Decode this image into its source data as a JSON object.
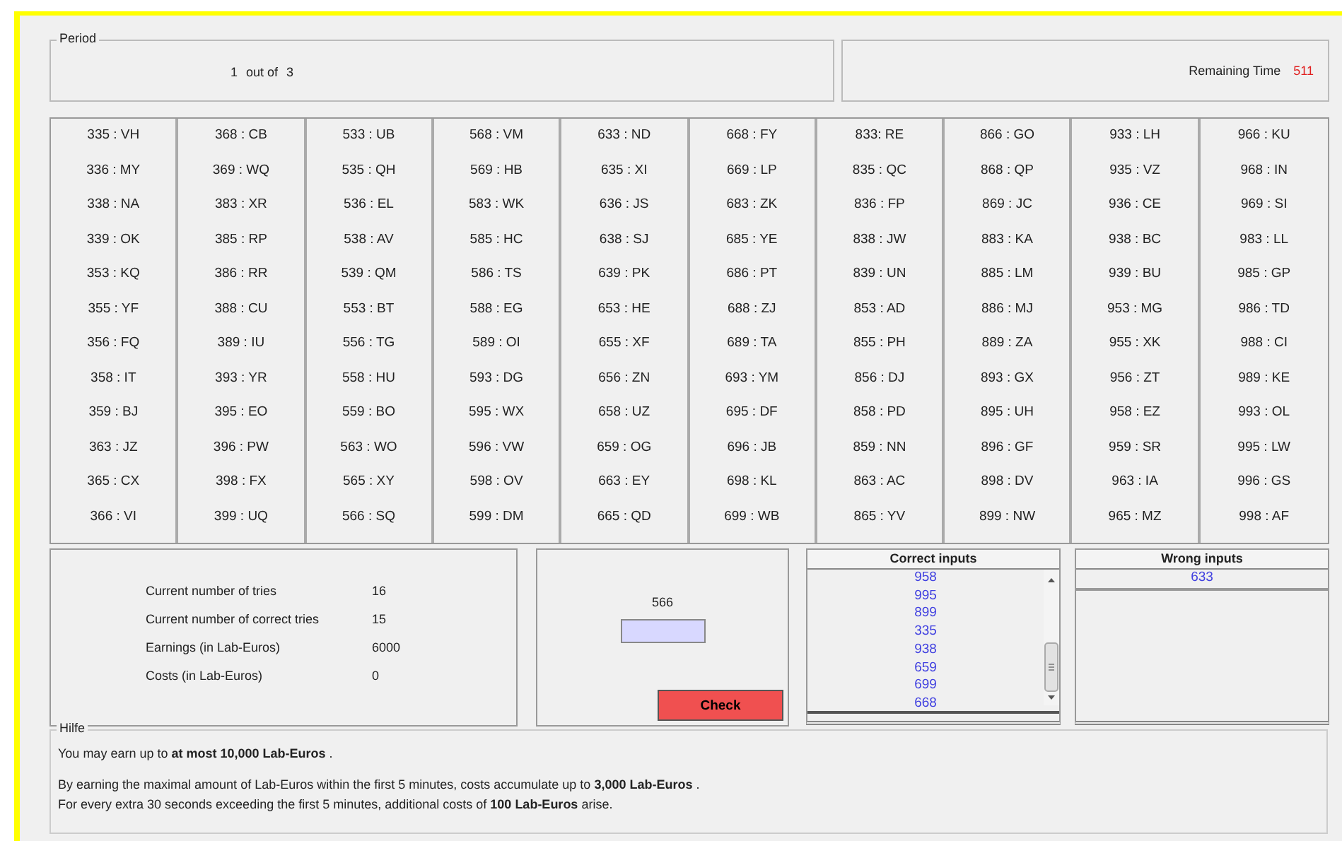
{
  "period": {
    "legend": "Period",
    "current": "1",
    "separator": "out of",
    "total": "3"
  },
  "remaining_time": {
    "label": "Remaining Time",
    "value": "511"
  },
  "grid": {
    "columns": [
      [
        "335 : VH",
        "336 : MY",
        "338 : NA",
        "339 : OK",
        "353 : KQ",
        "355 : YF",
        "356 : FQ",
        "358 : IT",
        "359 : BJ",
        "363 : JZ",
        "365 : CX",
        "366 : VI"
      ],
      [
        "368 : CB",
        "369 : WQ",
        "383 : XR",
        "385 : RP",
        "386 : RR",
        "388 : CU",
        "389 : IU",
        "393 : YR",
        "395 : EO",
        "396 : PW",
        "398 : FX",
        "399 : UQ"
      ],
      [
        "533 : UB",
        "535 : QH",
        "536 : EL",
        "538 : AV",
        "539 : QM",
        "553 : BT",
        "556 : TG",
        "558 : HU",
        "559 : BO",
        "563 : WO",
        "565 : XY",
        "566 : SQ"
      ],
      [
        "568 : VM",
        "569 : HB",
        "583 : WK",
        "585 : HC",
        "586 : TS",
        "588 : EG",
        "589 : OI",
        "593 : DG",
        "595 : WX",
        "596 : VW",
        "598 : OV",
        "599 : DM"
      ],
      [
        "633 : ND",
        "635 : XI",
        "636 : JS",
        "638 : SJ",
        "639 : PK",
        "653 : HE",
        "655 : XF",
        "656 : ZN",
        "658 : UZ",
        "659 : OG",
        "663 : EY",
        "665 : QD"
      ],
      [
        "668 : FY",
        "669 : LP",
        "683 : ZK",
        "685 : YE",
        "686 : PT",
        "688 : ZJ",
        "689 : TA",
        "693 : YM",
        "695 : DF",
        "696 : JB",
        "698 : KL",
        "699 : WB"
      ],
      [
        "833: RE",
        "835 : QC",
        "836 : FP",
        "838 : JW",
        "839 : UN",
        "853 : AD",
        "855 : PH",
        "856 : DJ",
        "858 : PD",
        "859 : NN",
        "863 : AC",
        "865 : YV"
      ],
      [
        "866 : GO",
        "868 : QP",
        "869 : JC",
        "883 : KA",
        "885 : LM",
        "886 : MJ",
        "889 : ZA",
        "893 : GX",
        "895 : UH",
        "896 : GF",
        "898 : DV",
        "899 : NW"
      ],
      [
        "933 : LH",
        "935 : VZ",
        "936 : CE",
        "938 : BC",
        "939 : BU",
        "953 : MG",
        "955 : XK",
        "956 : ZT",
        "958 : EZ",
        "959 : SR",
        "963 : IA",
        "965 : MZ"
      ],
      [
        "966 : KU",
        "968 : IN",
        "969 : SI",
        "983 : LL",
        "985 : GP",
        "986 : TD",
        "988 : CI",
        "989 : KE",
        "993 : OL",
        "995 : LW",
        "996 : GS",
        "998 : AF"
      ]
    ]
  },
  "stats": [
    {
      "label": "Current number of tries",
      "value": "16"
    },
    {
      "label": "Current number of correct tries",
      "value": "15"
    },
    {
      "label": "Earnings (in Lab-Euros)",
      "value": "6000"
    },
    {
      "label": "Costs (in Lab-Euros)",
      "value": "0"
    }
  ],
  "entry": {
    "prompt": "566",
    "button": "Check"
  },
  "correct_inputs": {
    "header": "Correct inputs",
    "items": [
      "958",
      "995",
      "899",
      "335",
      "938",
      "659",
      "699",
      "668"
    ]
  },
  "wrong_inputs": {
    "header": "Wrong inputs",
    "items": [
      "633"
    ]
  },
  "help": {
    "legend": "Hilfe",
    "paragraphs": [
      [
        "You may earn up to **at most 10,000 Lab-Euros** ."
      ],
      [
        "By earning the maximal amount of Lab-Euros within the first 5 minutes, costs accumulate up to **3,000 Lab-Euros** .",
        "For every extra 30 seconds exceeding the first 5 minutes, additional costs of **100 Lab-Euros** arise."
      ]
    ]
  }
}
